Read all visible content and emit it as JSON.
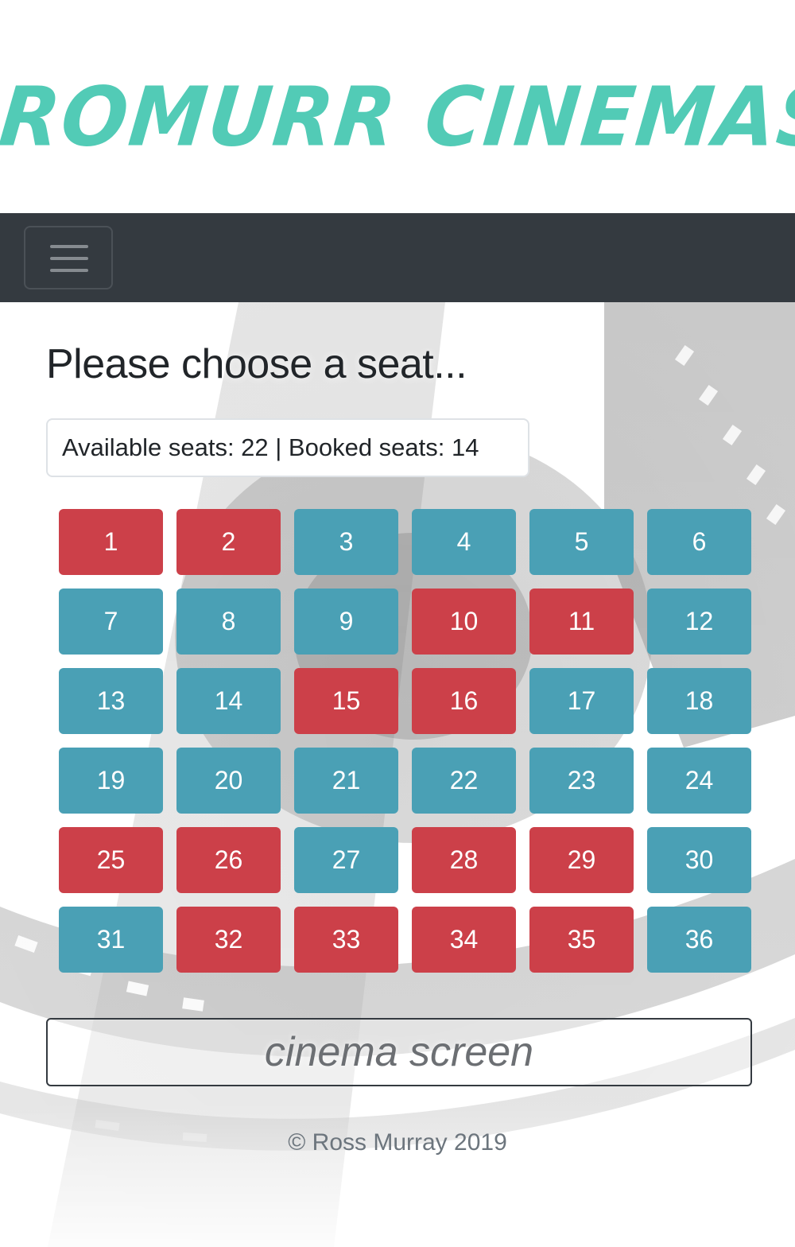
{
  "brand": {
    "logo_text": "ROMURR CINEMAS",
    "color": "#52cbb6"
  },
  "navbar": {
    "background": "#343a40",
    "toggler_icon": "hamburger-menu-icon"
  },
  "main": {
    "heading": "Please choose a seat...",
    "summary": "Available seats: 22 | Booked seats: 14",
    "seat_colors": {
      "available": "#4aa0b5",
      "booked": "#cc4049"
    },
    "seats": [
      {
        "number": "1",
        "status": "booked"
      },
      {
        "number": "2",
        "status": "booked"
      },
      {
        "number": "3",
        "status": "available"
      },
      {
        "number": "4",
        "status": "available"
      },
      {
        "number": "5",
        "status": "available"
      },
      {
        "number": "6",
        "status": "available"
      },
      {
        "number": "7",
        "status": "available"
      },
      {
        "number": "8",
        "status": "available"
      },
      {
        "number": "9",
        "status": "available"
      },
      {
        "number": "10",
        "status": "booked"
      },
      {
        "number": "11",
        "status": "booked"
      },
      {
        "number": "12",
        "status": "available"
      },
      {
        "number": "13",
        "status": "available"
      },
      {
        "number": "14",
        "status": "available"
      },
      {
        "number": "15",
        "status": "booked"
      },
      {
        "number": "16",
        "status": "booked"
      },
      {
        "number": "17",
        "status": "available"
      },
      {
        "number": "18",
        "status": "available"
      },
      {
        "number": "19",
        "status": "available"
      },
      {
        "number": "20",
        "status": "available"
      },
      {
        "number": "21",
        "status": "available"
      },
      {
        "number": "22",
        "status": "available"
      },
      {
        "number": "23",
        "status": "available"
      },
      {
        "number": "24",
        "status": "available"
      },
      {
        "number": "25",
        "status": "booked"
      },
      {
        "number": "26",
        "status": "booked"
      },
      {
        "number": "27",
        "status": "available"
      },
      {
        "number": "28",
        "status": "booked"
      },
      {
        "number": "29",
        "status": "booked"
      },
      {
        "number": "30",
        "status": "available"
      },
      {
        "number": "31",
        "status": "available"
      },
      {
        "number": "32",
        "status": "booked"
      },
      {
        "number": "33",
        "status": "booked"
      },
      {
        "number": "34",
        "status": "booked"
      },
      {
        "number": "35",
        "status": "booked"
      },
      {
        "number": "36",
        "status": "available"
      }
    ],
    "screen_label": "cinema screen"
  },
  "footer": {
    "text": "© Ross Murray 2019"
  }
}
